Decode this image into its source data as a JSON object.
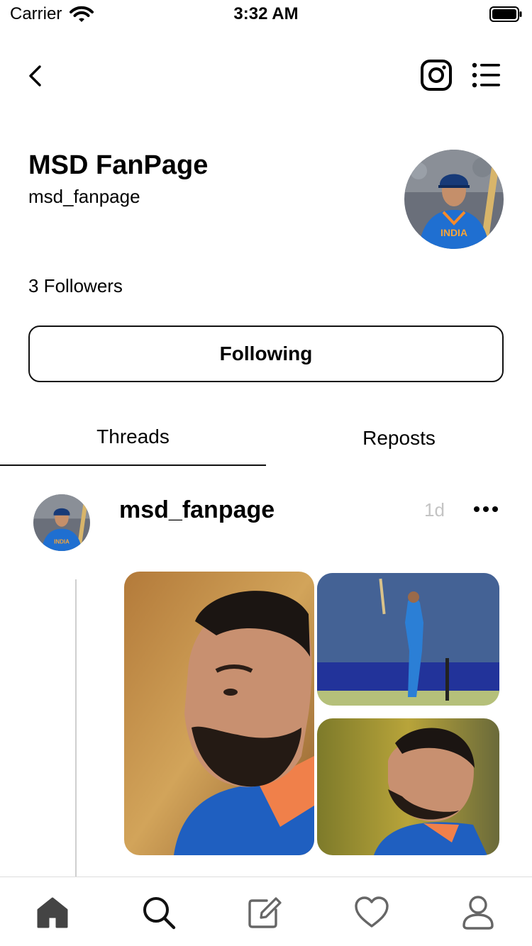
{
  "status_bar": {
    "carrier": "Carrier",
    "time": "3:32 AM"
  },
  "nav": {
    "back_icon": "chevron-left-icon",
    "instagram_icon": "instagram-icon",
    "menu_icon": "menu-list-icon"
  },
  "profile": {
    "display_name": "MSD FanPage",
    "username": "msd_fanpage",
    "followers": "3 Followers",
    "follow_button_label": "Following"
  },
  "tabs": [
    {
      "label": "Threads",
      "selected": true
    },
    {
      "label": "Reposts",
      "selected": false
    }
  ],
  "post": {
    "username": "msd_fanpage",
    "time": "1d",
    "more_icon": "more-horizontal-icon",
    "media_count": 3
  },
  "tab_bar": [
    {
      "name": "home",
      "icon": "home-icon",
      "active": true
    },
    {
      "name": "search",
      "icon": "search-icon",
      "active": false
    },
    {
      "name": "compose",
      "icon": "compose-icon",
      "active": false
    },
    {
      "name": "activity",
      "icon": "heart-icon",
      "active": false
    },
    {
      "name": "profile",
      "icon": "person-icon",
      "active": false
    }
  ],
  "colors": {
    "text": "#000000",
    "muted": "#c4c4c4",
    "icon_gray": "#444444",
    "jersey_blue": "#1f6fd1"
  }
}
